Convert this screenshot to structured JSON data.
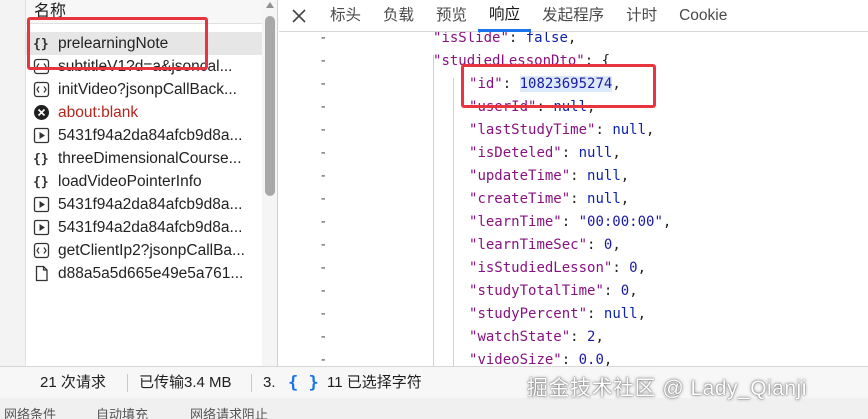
{
  "left": {
    "column_header": "名称",
    "requests": [
      {
        "name": "prelearningNote",
        "icon": "json-braces-icon",
        "selected": true
      },
      {
        "name": "subtitleV1?d=a&jsoncal...",
        "icon": "script-icon"
      },
      {
        "name": "initVideo?jsonpCallBack...",
        "icon": "script-icon"
      },
      {
        "name": "about:blank",
        "icon": "error-icon",
        "error": true
      },
      {
        "name": "5431f94a2da84afcb9d8a...",
        "icon": "media-play-icon"
      },
      {
        "name": "threeDimensionalCourse...",
        "icon": "json-braces-icon"
      },
      {
        "name": "loadVideoPointerInfo",
        "icon": "json-braces-icon"
      },
      {
        "name": "5431f94a2da84afcb9d8a...",
        "icon": "media-play-icon"
      },
      {
        "name": "5431f94a2da84afcb9d8a...",
        "icon": "media-play-icon"
      },
      {
        "name": "getClientIp2?jsonpCallBa...",
        "icon": "script-icon"
      },
      {
        "name": "d88a5a5d665e49e5a761...",
        "icon": "document-icon"
      }
    ]
  },
  "tabs": [
    "标头",
    "负载",
    "预览",
    "响应",
    "发起程序",
    "计时",
    "Cookie"
  ],
  "active_tab": "响应",
  "code_lines": [
    {
      "gutter": "-",
      "key": "isSlide",
      "value": "false",
      "type": "keyword",
      "suffix": ","
    },
    {
      "gutter": "-",
      "key": "studiedLessonDto",
      "value": "{",
      "type": "punct",
      "suffix": ""
    },
    {
      "gutter": "-",
      "key": "id",
      "value": "10823695274",
      "type": "id",
      "suffix": ","
    },
    {
      "gutter": "-",
      "key": "userId",
      "value": "null",
      "type": "keyword",
      "suffix": ","
    },
    {
      "gutter": "-",
      "key": "lastStudyTime",
      "value": "null",
      "type": "keyword",
      "suffix": ","
    },
    {
      "gutter": "-",
      "key": "isDeteled",
      "value": "null",
      "type": "keyword",
      "suffix": ","
    },
    {
      "gutter": "-",
      "key": "updateTime",
      "value": "null",
      "type": "keyword",
      "suffix": ","
    },
    {
      "gutter": "-",
      "key": "createTime",
      "value": "null",
      "type": "keyword",
      "suffix": ","
    },
    {
      "gutter": "-",
      "key": "learnTime",
      "value": "\"00:00:00\"",
      "type": "string",
      "suffix": ","
    },
    {
      "gutter": "-",
      "key": "learnTimeSec",
      "value": "0",
      "type": "number",
      "suffix": ","
    },
    {
      "gutter": "-",
      "key": "isStudiedLesson",
      "value": "0",
      "type": "number",
      "suffix": ","
    },
    {
      "gutter": "-",
      "key": "studyTotalTime",
      "value": "0",
      "type": "number",
      "suffix": ","
    },
    {
      "gutter": "-",
      "key": "studyPercent",
      "value": "null",
      "type": "keyword",
      "suffix": ","
    },
    {
      "gutter": "-",
      "key": "watchState",
      "value": "2",
      "type": "number",
      "suffix": ","
    },
    {
      "gutter": "-",
      "key": "videoSize",
      "value": "0.0",
      "type": "number",
      "suffix": ","
    }
  ],
  "status": {
    "requests": "21 次请求",
    "transferred": "已传输3.4 MB",
    "truncated": "3.",
    "selection": "11 已选择字符"
  },
  "bottom_strip": [
    "网络条件",
    "自动填充",
    "网络请求阻止"
  ],
  "watermark": "掘金技术社区 @ Lady_Qianji",
  "colors": {
    "highlight_box": "#e8343f",
    "accent": "#1a73e8"
  }
}
